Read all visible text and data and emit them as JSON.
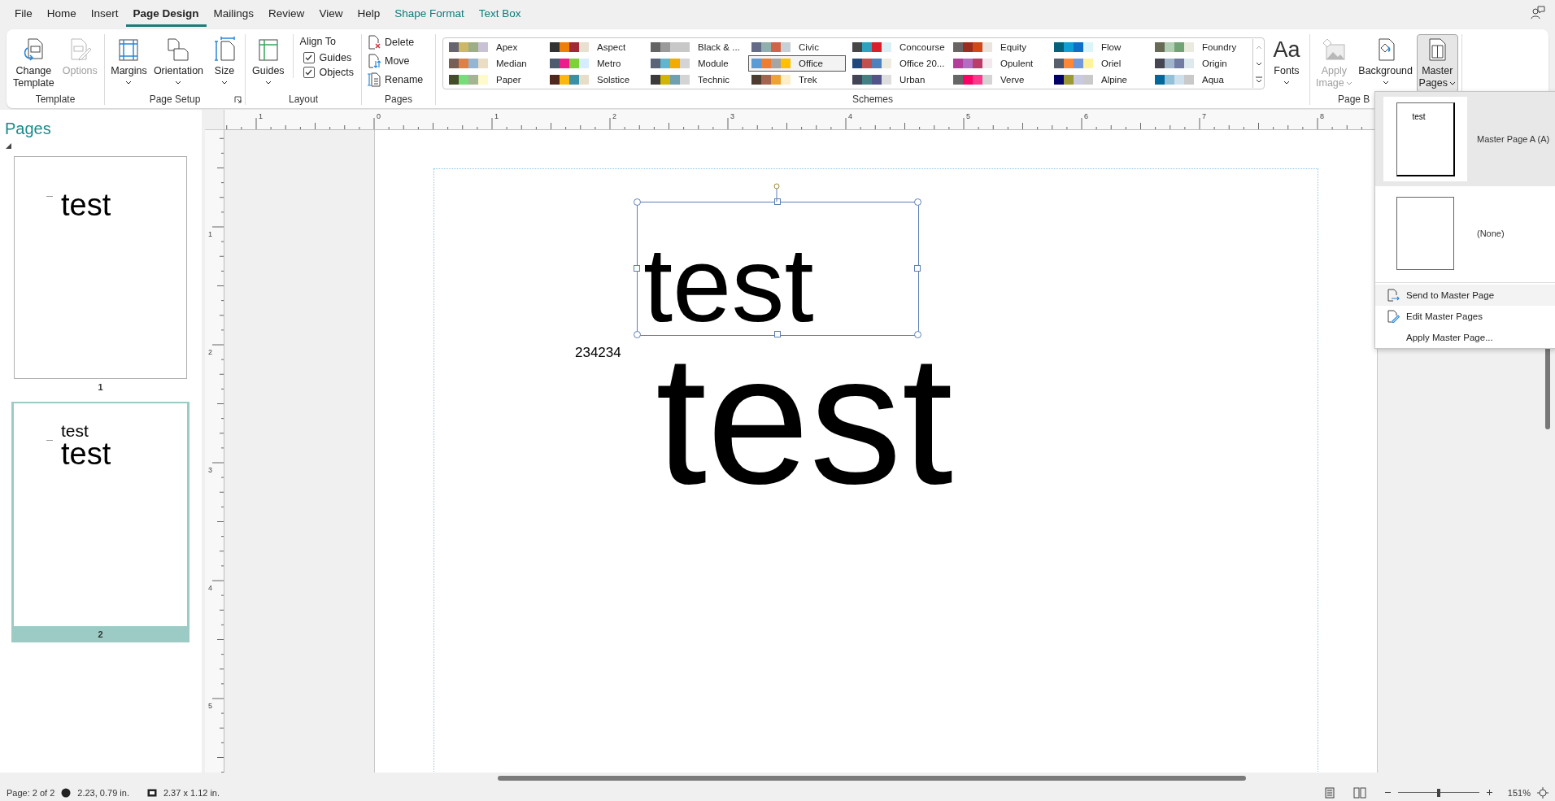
{
  "menu_tabs": [
    {
      "label": "File",
      "selected": false,
      "kind": "normal"
    },
    {
      "label": "Home",
      "selected": false,
      "kind": "normal"
    },
    {
      "label": "Insert",
      "selected": false,
      "kind": "normal"
    },
    {
      "label": "Page Design",
      "selected": true,
      "kind": "normal"
    },
    {
      "label": "Mailings",
      "selected": false,
      "kind": "normal"
    },
    {
      "label": "Review",
      "selected": false,
      "kind": "normal"
    },
    {
      "label": "View",
      "selected": false,
      "kind": "normal"
    },
    {
      "label": "Help",
      "selected": false,
      "kind": "normal"
    },
    {
      "label": "Shape Format",
      "selected": false,
      "kind": "contextual"
    },
    {
      "label": "Text Box",
      "selected": false,
      "kind": "contextual"
    }
  ],
  "ribbon": {
    "groups": [
      {
        "label": "Template",
        "launcher": false,
        "items": [
          {
            "kind": "large",
            "lines": [
              "Change",
              "Template"
            ],
            "dropdown": false,
            "disabled": false,
            "pressed": false
          },
          {
            "kind": "large",
            "lines": [
              "Options"
            ],
            "dropdown": false,
            "disabled": true,
            "pressed": false
          }
        ]
      },
      {
        "label": "Page Setup",
        "launcher": true,
        "items": [
          {
            "kind": "large",
            "lines": [
              "Margins"
            ],
            "dropdown": true,
            "inline_chevron": false,
            "disabled": false,
            "pressed": false
          },
          {
            "kind": "large",
            "lines": [
              "Orientation"
            ],
            "dropdown": true,
            "inline_chevron": false,
            "disabled": false,
            "pressed": false
          },
          {
            "kind": "large",
            "lines": [
              "Size"
            ],
            "dropdown": true,
            "inline_chevron": false,
            "disabled": false,
            "pressed": false
          }
        ]
      },
      {
        "label": "Layout",
        "launcher": false,
        "items": [
          {
            "kind": "large",
            "lines": [
              "Guides"
            ],
            "dropdown": true,
            "inline_chevron": false,
            "disabled": false,
            "pressed": false
          },
          {
            "kind": "heading",
            "label": "Align To"
          },
          {
            "kind": "checkbox",
            "label": "Guides",
            "checked": true
          },
          {
            "kind": "checkbox",
            "label": "Objects",
            "checked": true
          }
        ]
      },
      {
        "label": "Pages",
        "launcher": false,
        "items": [
          {
            "kind": "small",
            "label": "Delete"
          },
          {
            "kind": "small",
            "label": "Move"
          },
          {
            "kind": "small",
            "label": "Rename"
          }
        ]
      },
      {
        "label": "Schemes",
        "launcher": false,
        "items": [
          {
            "kind": "gallery",
            "schemes": [
              {
                "name": "Apex",
                "selected": false,
                "swatches": [
                  {
                    "color": "#66646e"
                  },
                  {
                    "color": "#cdb865"
                  },
                  {
                    "color": "#9caf84"
                  },
                  {
                    "color": "#c9c2d4"
                  }
                ]
              },
              {
                "name": "Aspect",
                "selected": false,
                "swatches": [
                  {
                    "color": "#323232"
                  },
                  {
                    "color": "#f07f09"
                  },
                  {
                    "color": "#9f2936"
                  },
                  {
                    "color": "#e8e0d0"
                  }
                ]
              },
              {
                "name": "Black & ...",
                "selected": false,
                "swatches": [
                  {
                    "color": "#646464"
                  },
                  {
                    "color": "#9a9a9a"
                  },
                  {
                    "color": "#c8c8c8"
                  },
                  {
                    "color": "#c8c8c8"
                  }
                ]
              },
              {
                "name": "Civic",
                "selected": false,
                "swatches": [
                  {
                    "color": "#646b86"
                  },
                  {
                    "color": "#8fb0ad"
                  },
                  {
                    "color": "#d16349"
                  },
                  {
                    "color": "#c5d1d7"
                  }
                ]
              },
              {
                "name": "Concourse",
                "selected": false,
                "swatches": [
                  {
                    "color": "#464646"
                  },
                  {
                    "color": "#2da2bf"
                  },
                  {
                    "color": "#da1f28"
                  },
                  {
                    "color": "#dbf0f5"
                  }
                ]
              },
              {
                "name": "Equity",
                "selected": false,
                "swatches": [
                  {
                    "color": "#696464"
                  },
                  {
                    "color": "#992e1f"
                  },
                  {
                    "color": "#d34817"
                  },
                  {
                    "color": "#e9e5dc"
                  }
                ]
              },
              {
                "name": "Flow",
                "selected": false,
                "swatches": [
                  {
                    "color": "#04617b"
                  },
                  {
                    "color": "#0f9ed5"
                  },
                  {
                    "color": "#0f6fc6"
                  },
                  {
                    "color": "#dbf5f9"
                  }
                ]
              },
              {
                "name": "Foundry",
                "selected": false,
                "swatches": [
                  {
                    "color": "#676a55"
                  },
                  {
                    "color": "#b1cfb4"
                  },
                  {
                    "color": "#72a376"
                  },
                  {
                    "color": "#eaebde"
                  }
                ]
              },
              {
                "name": "Median",
                "selected": false,
                "swatches": [
                  {
                    "color": "#775f55"
                  },
                  {
                    "color": "#dd8047"
                  },
                  {
                    "color": "#94b6d2"
                  },
                  {
                    "color": "#ebddc3"
                  }
                ]
              },
              {
                "name": "Metro",
                "selected": false,
                "swatches": [
                  {
                    "color": "#4e5b6f"
                  },
                  {
                    "color": "#eb1c8c"
                  },
                  {
                    "color": "#7fd13b"
                  },
                  {
                    "color": "#d6ecff"
                  }
                ]
              },
              {
                "name": "Module",
                "selected": false,
                "swatches": [
                  {
                    "color": "#5a6378"
                  },
                  {
                    "color": "#62b5cc"
                  },
                  {
                    "color": "#f0ad00"
                  },
                  {
                    "color": "#d4d4d4"
                  }
                ]
              },
              {
                "name": "Office",
                "selected": true,
                "swatches": [
                  {
                    "color": "#5b9bd5"
                  },
                  {
                    "color": "#ed7d31"
                  },
                  {
                    "color": "#a5a5a5"
                  },
                  {
                    "color": "#ffc000"
                  }
                ]
              },
              {
                "name": "Office 20...",
                "selected": false,
                "swatches": [
                  {
                    "color": "#1f497d"
                  },
                  {
                    "color": "#c0504d"
                  },
                  {
                    "color": "#4f81bd"
                  },
                  {
                    "color": "#eeece1"
                  }
                ]
              },
              {
                "name": "Opulent",
                "selected": false,
                "swatches": [
                  {
                    "color": "#b13f9a"
                  },
                  {
                    "color": "#b26cc0"
                  },
                  {
                    "color": "#b83d68"
                  },
                  {
                    "color": "#f4e7ed"
                  }
                ]
              },
              {
                "name": "Oriel",
                "selected": false,
                "swatches": [
                  {
                    "color": "#575f6d"
                  },
                  {
                    "color": "#fe8637"
                  },
                  {
                    "color": "#7598d9"
                  },
                  {
                    "color": "#fff39d"
                  }
                ]
              },
              {
                "name": "Origin",
                "selected": false,
                "swatches": [
                  {
                    "color": "#464653"
                  },
                  {
                    "color": "#a0b5c9"
                  },
                  {
                    "color": "#727ca3"
                  },
                  {
                    "color": "#dde9ec"
                  }
                ]
              },
              {
                "name": "Paper",
                "selected": false,
                "swatches": [
                  {
                    "color": "#444d26"
                  },
                  {
                    "color": "#77dd77"
                  },
                  {
                    "color": "#a5b592"
                  },
                  {
                    "color": "#fefac9"
                  }
                ]
              },
              {
                "name": "Solstice",
                "selected": false,
                "swatches": [
                  {
                    "color": "#4f271c"
                  },
                  {
                    "color": "#feb80a"
                  },
                  {
                    "color": "#3891a7"
                  },
                  {
                    "color": "#e7dec9"
                  }
                ]
              },
              {
                "name": "Technic",
                "selected": false,
                "swatches": [
                  {
                    "color": "#3b3b3b"
                  },
                  {
                    "color": "#d1b500"
                  },
                  {
                    "color": "#6fa0b0"
                  },
                  {
                    "color": "#d4d4d4"
                  }
                ]
              },
              {
                "name": "Trek",
                "selected": false,
                "swatches": [
                  {
                    "color": "#4e3b30"
                  },
                  {
                    "color": "#a5644e"
                  },
                  {
                    "color": "#f0a22e"
                  },
                  {
                    "color": "#fbeec9"
                  }
                ]
              },
              {
                "name": "Urban",
                "selected": false,
                "swatches": [
                  {
                    "color": "#424456"
                  },
                  {
                    "color": "#438086"
                  },
                  {
                    "color": "#53548a"
                  },
                  {
                    "color": "#dedede"
                  }
                ]
              },
              {
                "name": "Verve",
                "selected": false,
                "swatches": [
                  {
                    "color": "#666666"
                  },
                  {
                    "color": "#ff0066"
                  },
                  {
                    "color": "#ff388c"
                  },
                  {
                    "color": "#d4d4d4"
                  }
                ]
              },
              {
                "name": "Alpine",
                "selected": false,
                "swatches": [
                  {
                    "color": "#000066"
                  },
                  {
                    "color": "#9a9933"
                  },
                  {
                    "color": "#c9c9e1"
                  },
                  {
                    "color": "#c9c9c9"
                  }
                ]
              },
              {
                "name": "Aqua",
                "selected": false,
                "swatches": [
                  {
                    "color": "#00689b"
                  },
                  {
                    "color": "#93c1d9"
                  },
                  {
                    "color": "#cde0eb"
                  },
                  {
                    "color": "#c9c9c9"
                  }
                ]
              }
            ]
          },
          {
            "kind": "large",
            "lines": [
              "Fonts"
            ],
            "icon_text": "Aa",
            "dropdown": true,
            "inline_chevron": false,
            "disabled": false,
            "pressed": false
          }
        ]
      },
      {
        "label": "Page B",
        "launcher": false,
        "items": [
          {
            "kind": "large",
            "lines": [
              "Apply",
              "Image"
            ],
            "dropdown": true,
            "inline_chevron": true,
            "disabled": true,
            "pressed": false
          },
          {
            "kind": "large",
            "lines": [
              "Background"
            ],
            "dropdown": true,
            "inline_chevron": false,
            "disabled": false,
            "pressed": false
          },
          {
            "kind": "large",
            "lines": [
              "Master",
              "Pages"
            ],
            "dropdown": true,
            "inline_chevron": true,
            "disabled": false,
            "pressed": true
          }
        ]
      }
    ]
  },
  "pages_pane": {
    "title": "Pages",
    "pages": [
      {
        "number": "1",
        "selected": false,
        "texts": [
          {
            "text": "test",
            "kind": "large"
          }
        ]
      },
      {
        "number": "2",
        "selected": true,
        "texts": [
          {
            "text": "test",
            "kind": "small"
          },
          {
            "text": "test",
            "kind": "large"
          }
        ]
      }
    ]
  },
  "rulers": {
    "horizontal": [
      "1",
      "0",
      "1",
      "2",
      "3",
      "4",
      "5",
      "6",
      "7",
      "8"
    ],
    "vertical": [
      "1",
      "2",
      "3",
      "4",
      "5"
    ]
  },
  "canvas": {
    "text_box": {
      "text": "test",
      "selected": true
    },
    "texts": [
      {
        "text": "234234",
        "kind": "small"
      },
      {
        "text": "test",
        "kind": "huge"
      }
    ]
  },
  "master_pages_menu": {
    "gallery": [
      {
        "label": "Master Page A (A)",
        "selected": true,
        "thumb_text": "test"
      },
      {
        "label": "(None)",
        "selected": false
      }
    ],
    "commands": [
      {
        "label": "Send to Master Page",
        "highlighted": true
      },
      {
        "label": "Edit Master Pages",
        "highlighted": false
      },
      {
        "label": "Apply Master Page...",
        "highlighted": false
      }
    ]
  },
  "status_bar": {
    "page": "Page: 2 of 2",
    "position": "2.23, 0.79 in.",
    "size": "2.37 x 1.12 in.",
    "zoom": {
      "level": 0.5,
      "label": "151%"
    }
  }
}
